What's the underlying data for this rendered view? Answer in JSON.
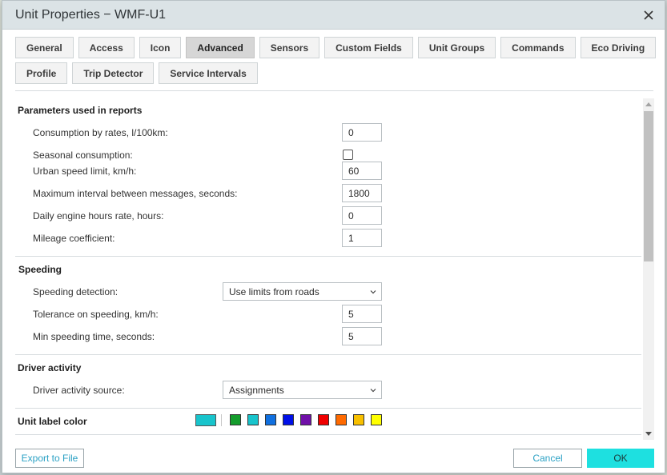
{
  "dialog": {
    "title": "Unit Properties − WMF-U1"
  },
  "tabs": {
    "row1": [
      {
        "label": "General",
        "active": false
      },
      {
        "label": "Access",
        "active": false
      },
      {
        "label": "Icon",
        "active": false
      },
      {
        "label": "Advanced",
        "active": true
      },
      {
        "label": "Sensors",
        "active": false
      },
      {
        "label": "Custom Fields",
        "active": false
      },
      {
        "label": "Unit Groups",
        "active": false
      },
      {
        "label": "Commands",
        "active": false
      },
      {
        "label": "Eco Driving",
        "active": false
      }
    ],
    "row2": [
      {
        "label": "Profile",
        "active": false
      },
      {
        "label": "Trip Detector",
        "active": false
      },
      {
        "label": "Service Intervals",
        "active": false
      }
    ]
  },
  "reports": {
    "section_title": "Parameters used in reports",
    "consumption_label": "Consumption by rates, l/100km:",
    "consumption_value": "0",
    "seasonal_label": "Seasonal consumption:",
    "seasonal_checked": false,
    "urban_label": "Urban speed limit, km/h:",
    "urban_value": "60",
    "max_interval_label": "Maximum interval between messages, seconds:",
    "max_interval_value": "1800",
    "engine_hours_label": "Daily engine hours rate, hours:",
    "engine_hours_value": "0",
    "mileage_label": "Mileage coefficient:",
    "mileage_value": "1"
  },
  "speeding": {
    "section_title": "Speeding",
    "detection_label": "Speeding detection:",
    "detection_value": "Use limits from roads",
    "tolerance_label": "Tolerance on speeding, km/h:",
    "tolerance_value": "5",
    "min_time_label": "Min speeding time, seconds:",
    "min_time_value": "5"
  },
  "driver": {
    "section_title": "Driver activity",
    "source_label": "Driver activity source:",
    "source_value": "Assignments"
  },
  "label_color": {
    "section_title": "Unit label color",
    "selected": "#18c4cc",
    "palette": [
      "#149c2c",
      "#18c4cc",
      "#1070e0",
      "#0010e8",
      "#7010a8",
      "#f00000",
      "#ff6a00",
      "#f8c000",
      "#ffff00"
    ]
  },
  "footer": {
    "export_label": "Export to File",
    "cancel_label": "Cancel",
    "ok_label": "OK"
  },
  "colors": {
    "accent": "#1ee0e0",
    "link": "#2aa1c4",
    "titlebar": "#dbe3e6"
  }
}
